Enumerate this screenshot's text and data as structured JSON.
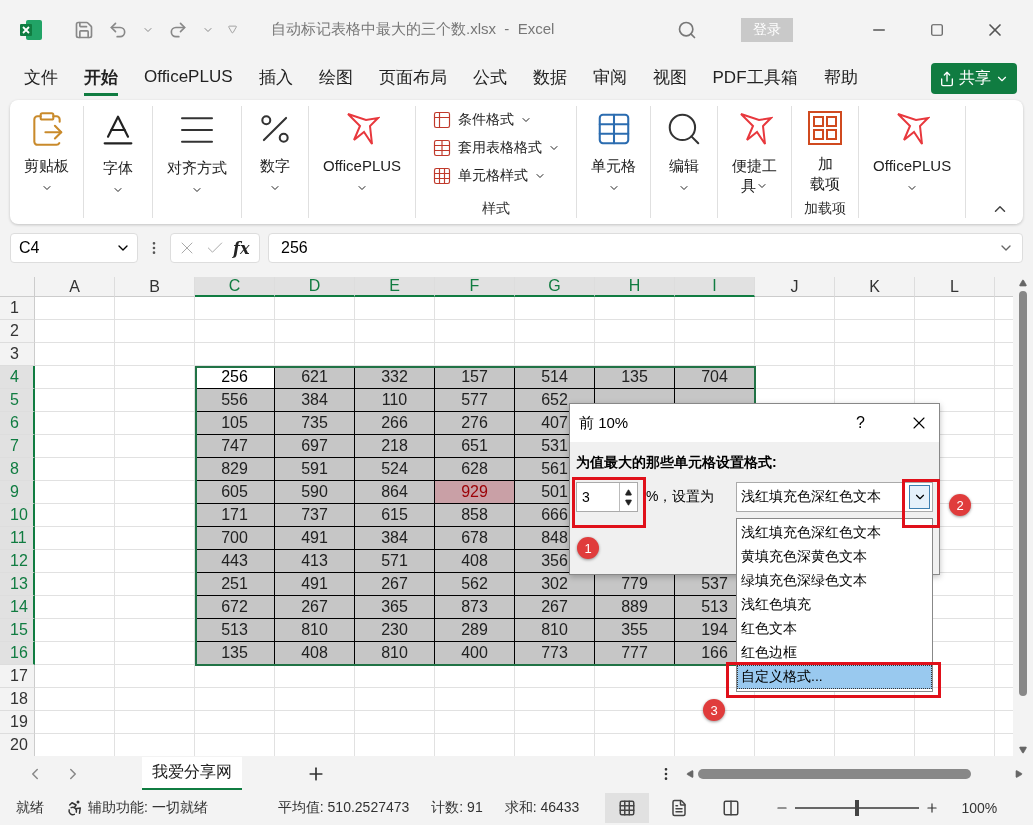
{
  "window": {
    "title": "自动标记表格中最大的三个数.xlsx  -  Excel",
    "sign_in": "登录"
  },
  "menu_tabs": [
    {
      "label": "文件",
      "selected": false
    },
    {
      "label": "开始",
      "selected": true
    },
    {
      "label": "OfficePLUS",
      "selected": false
    },
    {
      "label": "插入",
      "selected": false
    },
    {
      "label": "绘图",
      "selected": false
    },
    {
      "label": "页面布局",
      "selected": false
    },
    {
      "label": "公式",
      "selected": false
    },
    {
      "label": "数据",
      "selected": false
    },
    {
      "label": "审阅",
      "selected": false
    },
    {
      "label": "视图",
      "selected": false
    },
    {
      "label": "PDF工具箱",
      "selected": false
    },
    {
      "label": "帮助",
      "selected": false
    }
  ],
  "share": "共享",
  "ribbon": {
    "groups": [
      {
        "kind": "large",
        "lines": [
          "剪贴板"
        ],
        "caret": true
      },
      {
        "kind": "large",
        "lines": [
          "字体"
        ],
        "caret": true
      },
      {
        "kind": "large",
        "lines": [
          "对齐方式"
        ],
        "caret": true
      },
      {
        "kind": "large",
        "lines": [
          "数字"
        ],
        "caret": true
      },
      {
        "kind": "large",
        "lines": [
          "OfficePLUS"
        ],
        "caret": true
      },
      {
        "kind": "stack",
        "items": [
          "条件格式",
          "套用表格格式",
          "单元格样式"
        ],
        "group_label": "样式"
      },
      {
        "kind": "large",
        "lines": [
          "单元格"
        ],
        "caret": true
      },
      {
        "kind": "large",
        "lines": [
          "编辑"
        ],
        "caret": true
      },
      {
        "kind": "large",
        "lines": [
          "便捷工",
          "具"
        ],
        "caret": true
      },
      {
        "kind": "large",
        "lines": [
          "加",
          "载项"
        ],
        "caret": false,
        "group_label": "加载项"
      },
      {
        "kind": "large",
        "lines": [
          "OfficePLUS"
        ],
        "caret": true
      }
    ]
  },
  "formula_bar": {
    "name_box": "C4",
    "function_label": "fx",
    "formula": "256"
  },
  "grid": {
    "columns": [
      {
        "label": "A",
        "selected": false
      },
      {
        "label": "B",
        "selected": false
      },
      {
        "label": "C",
        "selected": true
      },
      {
        "label": "D",
        "selected": true
      },
      {
        "label": "E",
        "selected": true
      },
      {
        "label": "F",
        "selected": true
      },
      {
        "label": "G",
        "selected": true
      },
      {
        "label": "H",
        "selected": true
      },
      {
        "label": "I",
        "selected": true
      },
      {
        "label": "J",
        "selected": false
      },
      {
        "label": "K",
        "selected": false
      },
      {
        "label": "L",
        "selected": false
      }
    ],
    "rows": [
      {
        "label": "1",
        "selected": false,
        "cells": []
      },
      {
        "label": "2",
        "selected": false,
        "cells": []
      },
      {
        "label": "3",
        "selected": false,
        "cells": []
      },
      {
        "label": "4",
        "selected": true,
        "cells": [
          {
            "kind": "blank"
          },
          {
            "kind": "blank"
          },
          {
            "value": "256",
            "kind": "active"
          },
          {
            "value": "621",
            "kind": "plain"
          },
          {
            "value": "332",
            "kind": "plain"
          },
          {
            "value": "157",
            "kind": "plain"
          },
          {
            "value": "514",
            "kind": "plain"
          },
          {
            "value": "135",
            "kind": "plain"
          },
          {
            "value": "704",
            "kind": "plain"
          }
        ]
      },
      {
        "label": "5",
        "selected": true,
        "cells": [
          {
            "kind": "blank"
          },
          {
            "kind": "blank"
          },
          {
            "value": "556",
            "kind": "plain"
          },
          {
            "value": "384",
            "kind": "plain"
          },
          {
            "value": "110",
            "kind": "plain"
          },
          {
            "value": "577",
            "kind": "plain"
          },
          {
            "value": "652",
            "kind": "plain"
          }
        ]
      },
      {
        "label": "6",
        "selected": true,
        "cells": [
          {
            "kind": "blank"
          },
          {
            "kind": "blank"
          },
          {
            "value": "105",
            "kind": "plain"
          },
          {
            "value": "735",
            "kind": "plain"
          },
          {
            "value": "266",
            "kind": "plain"
          },
          {
            "value": "276",
            "kind": "plain"
          },
          {
            "value": "407",
            "kind": "plain"
          }
        ]
      },
      {
        "label": "7",
        "selected": true,
        "cells": [
          {
            "kind": "blank"
          },
          {
            "kind": "blank"
          },
          {
            "value": "747",
            "kind": "plain"
          },
          {
            "value": "697",
            "kind": "plain"
          },
          {
            "value": "218",
            "kind": "plain"
          },
          {
            "value": "651",
            "kind": "plain"
          },
          {
            "value": "531",
            "kind": "plain"
          }
        ]
      },
      {
        "label": "8",
        "selected": true,
        "cells": [
          {
            "kind": "blank"
          },
          {
            "kind": "blank"
          },
          {
            "value": "829",
            "kind": "plain"
          },
          {
            "value": "591",
            "kind": "plain"
          },
          {
            "value": "524",
            "kind": "plain"
          },
          {
            "value": "628",
            "kind": "plain"
          },
          {
            "value": "561",
            "kind": "plain"
          }
        ]
      },
      {
        "label": "9",
        "selected": true,
        "cells": [
          {
            "kind": "blank"
          },
          {
            "kind": "blank"
          },
          {
            "value": "605",
            "kind": "plain"
          },
          {
            "value": "590",
            "kind": "plain"
          },
          {
            "value": "864",
            "kind": "plain"
          },
          {
            "value": "929",
            "kind": "highlight"
          },
          {
            "value": "501",
            "kind": "plain"
          }
        ]
      },
      {
        "label": "10",
        "selected": true,
        "cells": [
          {
            "kind": "blank"
          },
          {
            "kind": "blank"
          },
          {
            "value": "171",
            "kind": "plain"
          },
          {
            "value": "737",
            "kind": "plain"
          },
          {
            "value": "615",
            "kind": "plain"
          },
          {
            "value": "858",
            "kind": "plain"
          },
          {
            "value": "666",
            "kind": "plain"
          }
        ]
      },
      {
        "label": "11",
        "selected": true,
        "cells": [
          {
            "kind": "blank"
          },
          {
            "kind": "blank"
          },
          {
            "value": "700",
            "kind": "plain"
          },
          {
            "value": "491",
            "kind": "plain"
          },
          {
            "value": "384",
            "kind": "plain"
          },
          {
            "value": "678",
            "kind": "plain"
          },
          {
            "value": "848",
            "kind": "plain"
          }
        ]
      },
      {
        "label": "12",
        "selected": true,
        "cells": [
          {
            "kind": "blank"
          },
          {
            "kind": "blank"
          },
          {
            "value": "443",
            "kind": "plain"
          },
          {
            "value": "413",
            "kind": "plain"
          },
          {
            "value": "571",
            "kind": "plain"
          },
          {
            "value": "408",
            "kind": "plain"
          },
          {
            "value": "356",
            "kind": "plain"
          }
        ]
      },
      {
        "label": "13",
        "selected": true,
        "cells": [
          {
            "kind": "blank"
          },
          {
            "kind": "blank"
          },
          {
            "value": "251",
            "kind": "plain"
          },
          {
            "value": "491",
            "kind": "plain"
          },
          {
            "value": "267",
            "kind": "plain"
          },
          {
            "value": "562",
            "kind": "plain"
          },
          {
            "value": "302",
            "kind": "plain"
          },
          {
            "value": "779",
            "kind": "plain"
          },
          {
            "value": "537",
            "kind": "plain"
          }
        ]
      },
      {
        "label": "14",
        "selected": true,
        "cells": [
          {
            "kind": "blank"
          },
          {
            "kind": "blank"
          },
          {
            "value": "672",
            "kind": "plain"
          },
          {
            "value": "267",
            "kind": "plain"
          },
          {
            "value": "365",
            "kind": "plain"
          },
          {
            "value": "873",
            "kind": "plain"
          },
          {
            "value": "267",
            "kind": "plain"
          },
          {
            "value": "889",
            "kind": "plain"
          },
          {
            "value": "513",
            "kind": "plain"
          }
        ]
      },
      {
        "label": "15",
        "selected": true,
        "cells": [
          {
            "kind": "blank"
          },
          {
            "kind": "blank"
          },
          {
            "value": "513",
            "kind": "plain"
          },
          {
            "value": "810",
            "kind": "plain"
          },
          {
            "value": "230",
            "kind": "plain"
          },
          {
            "value": "289",
            "kind": "plain"
          },
          {
            "value": "810",
            "kind": "plain"
          },
          {
            "value": "355",
            "kind": "plain"
          },
          {
            "value": "194",
            "kind": "plain"
          }
        ]
      },
      {
        "label": "16",
        "selected": true,
        "cells": [
          {
            "kind": "blank"
          },
          {
            "kind": "blank"
          },
          {
            "value": "135",
            "kind": "plain"
          },
          {
            "value": "408",
            "kind": "plain"
          },
          {
            "value": "810",
            "kind": "plain"
          },
          {
            "value": "400",
            "kind": "plain"
          },
          {
            "value": "773",
            "kind": "plain"
          },
          {
            "value": "777",
            "kind": "plain"
          },
          {
            "value": "166",
            "kind": "plain"
          }
        ]
      },
      {
        "label": "17",
        "selected": false,
        "cells": []
      },
      {
        "label": "18",
        "selected": false,
        "cells": []
      },
      {
        "label": "19",
        "selected": false,
        "cells": []
      },
      {
        "label": "20",
        "selected": false,
        "cells": []
      }
    ]
  },
  "dialog": {
    "title": "前 10%",
    "help": "?",
    "prompt": "为值最大的那些单元格设置格式:",
    "spin_value": "3",
    "unit_label": "%，设置为",
    "format_value": "浅红填充色深红色文本",
    "options": [
      {
        "label": "浅红填充色深红色文本",
        "selected": false
      },
      {
        "label": "黄填充色深黄色文本",
        "selected": false
      },
      {
        "label": "绿填充色深绿色文本",
        "selected": false
      },
      {
        "label": "浅红色填充",
        "selected": false
      },
      {
        "label": "红色文本",
        "selected": false
      },
      {
        "label": "红色边框",
        "selected": false
      },
      {
        "label": "自定义格式...",
        "selected": true
      }
    ]
  },
  "annotations": [
    {
      "label": "1"
    },
    {
      "label": "2"
    },
    {
      "label": "3"
    }
  ],
  "sheet_tabs": [
    {
      "label": "我爱分享网",
      "selected": true
    }
  ],
  "status_bar": {
    "ready": "就绪",
    "accessibility": "辅助功能: 一切就绪",
    "average": "平均值: 510.2527473",
    "count": "计数: 91",
    "sum": "求和: 46433",
    "views": [
      {
        "kind": "normal",
        "selected": true
      },
      {
        "kind": "page_layout",
        "selected": false
      },
      {
        "kind": "page_break",
        "selected": false
      }
    ],
    "zoom": {
      "level": 0.5,
      "reading": "100%"
    }
  }
}
